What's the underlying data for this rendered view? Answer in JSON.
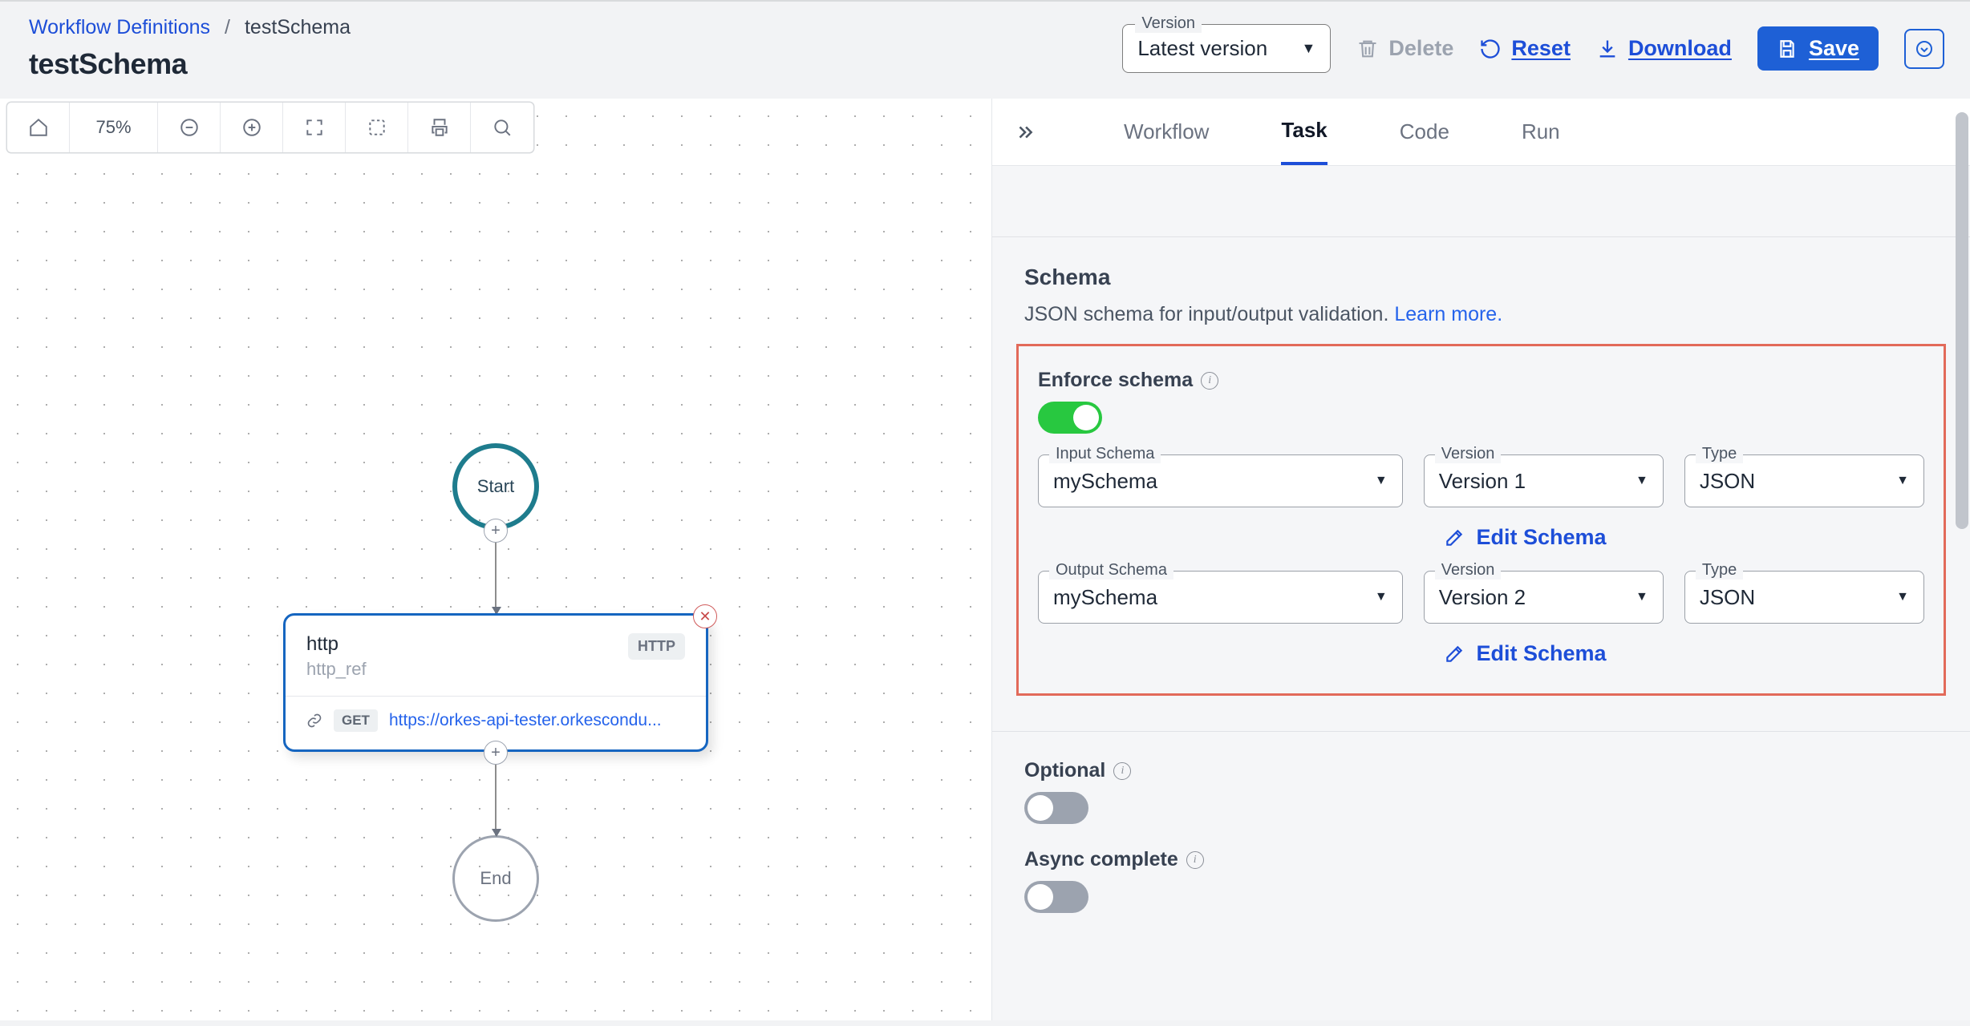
{
  "breadcrumb": {
    "root": "Workflow Definitions",
    "current": "testSchema"
  },
  "page_title": "testSchema",
  "header": {
    "version_legend": "Version",
    "version_value": "Latest version",
    "delete": "Delete",
    "reset": "Reset",
    "download": "Download",
    "save": "Save"
  },
  "canvas_toolbar": {
    "zoom": "75%"
  },
  "graph": {
    "start_label": "Start",
    "end_label": "End",
    "task": {
      "name": "http",
      "ref": "http_ref",
      "type_pill": "HTTP",
      "method": "GET",
      "url": "https://orkes-api-tester.orkescondu..."
    }
  },
  "tabs": {
    "workflow": "Workflow",
    "task": "Task",
    "code": "Code",
    "run": "Run"
  },
  "schema_section": {
    "title": "Schema",
    "desc": "JSON schema for input/output validation. ",
    "learn_more": "Learn more.",
    "enforce_label": "Enforce schema",
    "edit_link": "Edit Schema",
    "labels": {
      "input": "Input Schema",
      "output": "Output Schema",
      "version": "Version",
      "type": "Type"
    },
    "input": {
      "schema": "mySchema",
      "version": "Version 1",
      "type": "JSON"
    },
    "output": {
      "schema": "mySchema",
      "version": "Version 2",
      "type": "JSON"
    }
  },
  "optional_label": "Optional",
  "async_label": "Async complete"
}
